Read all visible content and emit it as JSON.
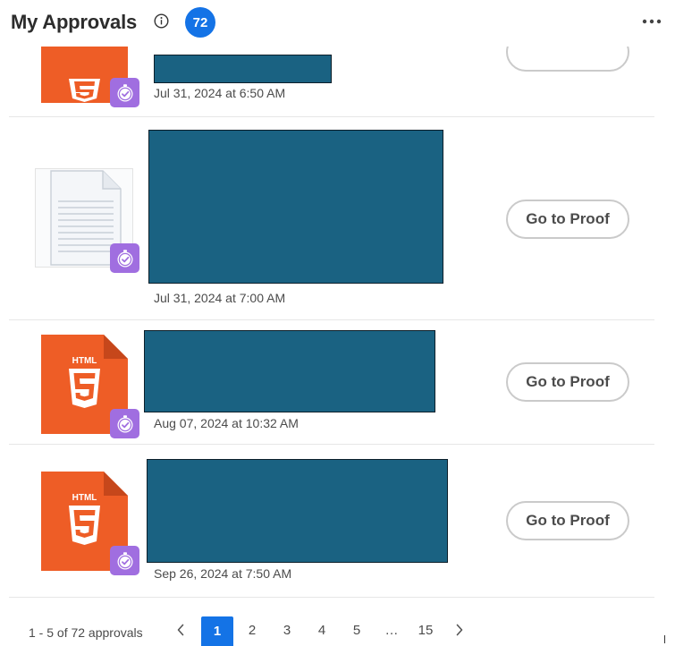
{
  "header": {
    "title": "My Approvals",
    "info_icon": "info-icon",
    "count": "72",
    "more_icon": "more-horizontal-icon"
  },
  "items": [
    {
      "thumbnail": "html5-icon",
      "status_icon": "approval-status-icon",
      "name": "",
      "date": "Jul 31, 2024 at 6:50 AM",
      "action": ""
    },
    {
      "thumbnail": "document-icon",
      "status_icon": "approval-status-icon",
      "name": "",
      "date": "Jul 31, 2024 at 7:00 AM",
      "action": "Go to Proof"
    },
    {
      "thumbnail": "html5-icon",
      "status_icon": "approval-status-icon",
      "name": "",
      "date": "Aug 07, 2024 at 10:32 AM",
      "action": "Go to Proof"
    },
    {
      "thumbnail": "html5-icon",
      "status_icon": "approval-status-icon",
      "name": "",
      "date": "Sep 26, 2024 at 7:50 AM",
      "action": "Go to Proof"
    }
  ],
  "pagination": {
    "range": "1 - 5 of 72 approvals",
    "prev_icon": "chevron-left-icon",
    "next_icon": "chevron-right-icon",
    "pages": [
      "1",
      "2",
      "3",
      "4",
      "5",
      "…",
      "15"
    ],
    "current_page": "1"
  },
  "colors": {
    "accent": "#1473e6",
    "html5_orange": "#ee5d26",
    "status_purple": "#a06ee0",
    "redaction": "#1a6282"
  }
}
